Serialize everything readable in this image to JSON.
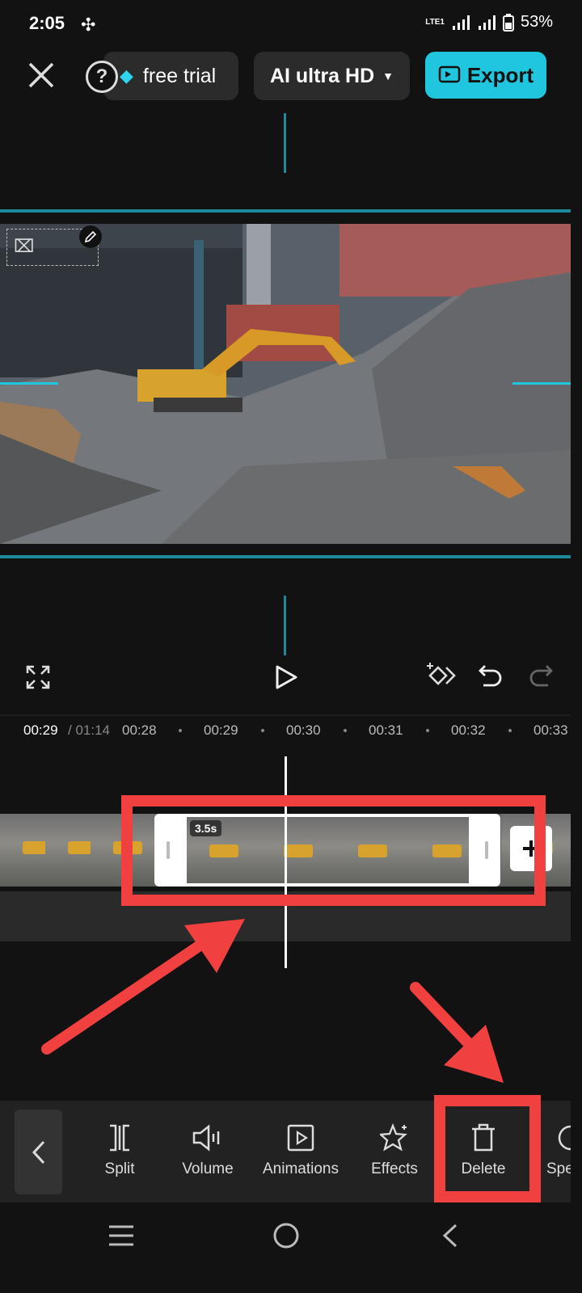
{
  "status_bar": {
    "time": "2:05",
    "network": "LTE1",
    "battery": "53%"
  },
  "top_bar": {
    "free_trial_label": "free trial",
    "quality_label": "AI ultra HD",
    "export_label": "Export"
  },
  "timeline": {
    "current_time": "00:29",
    "total_time": "/ 01:14",
    "ticks": [
      "00:28",
      "00:29",
      "00:30",
      "00:31",
      "00:32",
      "00:33"
    ],
    "clip_duration": "3.5s"
  },
  "toolbar": {
    "tools": [
      {
        "label": "Split",
        "icon": "split-icon"
      },
      {
        "label": "Volume",
        "icon": "volume-icon"
      },
      {
        "label": "Animations",
        "icon": "animations-icon"
      },
      {
        "label": "Effects",
        "icon": "effects-icon"
      },
      {
        "label": "Delete",
        "icon": "delete-icon"
      },
      {
        "label": "Spe",
        "icon": "speed-icon"
      }
    ]
  },
  "colors": {
    "accent": "#1fc6dd",
    "annotation": "#f04040",
    "background": "#121212"
  }
}
